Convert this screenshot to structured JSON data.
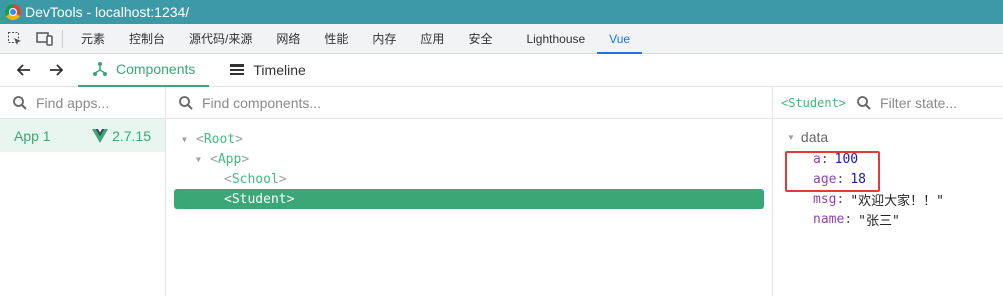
{
  "window": {
    "title": "DevTools - localhost:1234/"
  },
  "devtools_tabs": [
    "元素",
    "控制台",
    "源代码/来源",
    "网络",
    "性能",
    "内存",
    "应用",
    "安全",
    "Lighthouse",
    "Vue"
  ],
  "active_devtools_tab": "Vue",
  "toolbar": {
    "components_label": "Components",
    "timeline_label": "Timeline"
  },
  "apps": {
    "search_placeholder": "Find apps...",
    "items": [
      {
        "name": "App 1",
        "version": "2.7.15"
      }
    ]
  },
  "components": {
    "search_placeholder": "Find components...",
    "tree": [
      {
        "name": "Root",
        "depth": 0,
        "expanded": true
      },
      {
        "name": "App",
        "depth": 1,
        "expanded": true
      },
      {
        "name": "School",
        "depth": 2,
        "expanded": false
      },
      {
        "name": "Student",
        "depth": 2,
        "selected": true
      }
    ]
  },
  "state": {
    "component": "<Student>",
    "filter_placeholder": "Filter state...",
    "section": "data",
    "props": [
      {
        "key": "a",
        "value": "100",
        "kind": "num"
      },
      {
        "key": "age",
        "value": "18",
        "kind": "num"
      },
      {
        "key": "msg",
        "value": "\"欢迎大家！！\"",
        "kind": "str"
      },
      {
        "key": "name",
        "value": "\"张三\"",
        "kind": "str"
      }
    ]
  },
  "colors": {
    "accent": "#3ba776",
    "titlebar": "#3c9aa7",
    "highlight": "#e53935"
  }
}
